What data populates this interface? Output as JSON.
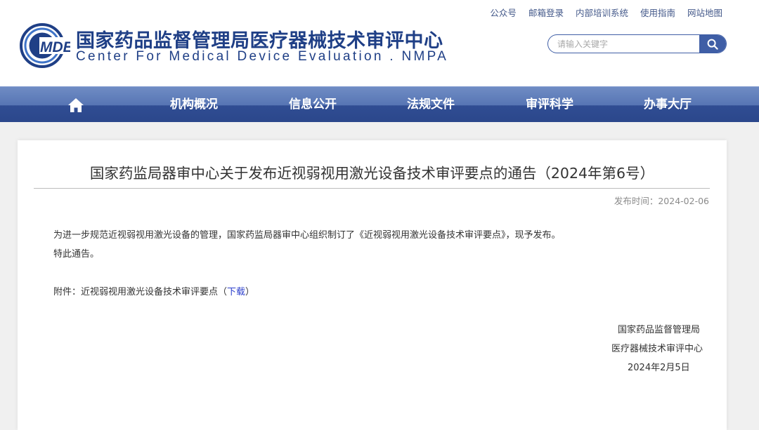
{
  "header": {
    "logo_text": "MDE",
    "title_cn": "国家药品监督管理局医疗器械技术审评中心",
    "title_en": "Center For Medical Device Evaluation . NMPA",
    "top_links": [
      "公众号",
      "邮箱登录",
      "内部培训系统",
      "使用指南",
      "网站地图"
    ],
    "search": {
      "placeholder": "请输入关键字",
      "icon": "search-icon"
    }
  },
  "nav": {
    "home_icon": "home-icon",
    "items": [
      "机构概况",
      "信息公开",
      "法规文件",
      "审评科学",
      "办事大厅"
    ]
  },
  "article": {
    "title": "国家药监局器审中心关于发布近视弱视用激光设备技术审评要点的通告（2024年第6号）",
    "publish_label": "发布时间：",
    "publish_date": "2024-02-06",
    "paragraph1": "为进一步规范近视弱视用激光设备的管理，国家药监局器审中心组织制订了《近视弱视用激光设备技术审评要点》，现予发布。",
    "paragraph2": "特此通告。",
    "attachment_prefix": "附件：近视弱视用激光设备技术审评要点（",
    "attachment_link": "下载",
    "attachment_suffix": "）",
    "signature": [
      "国家药品监督管理局",
      "医疗器械技术审评中心",
      "2024年2月5日"
    ]
  },
  "colors": {
    "brand_blue": "#1f3f86",
    "nav_top": "#6f8cc4",
    "nav_bottom": "#2b478b",
    "link": "#2c3fcc"
  }
}
